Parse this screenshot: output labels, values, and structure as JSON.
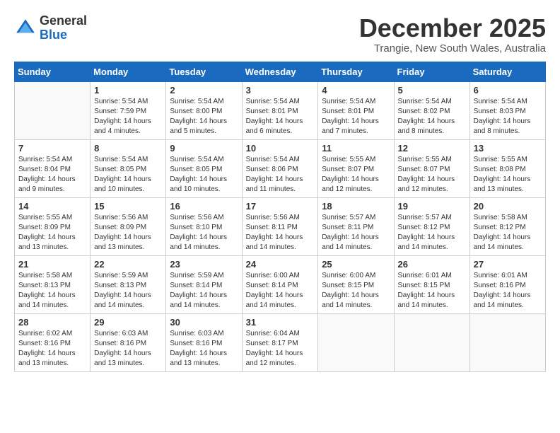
{
  "header": {
    "logo_general": "General",
    "logo_blue": "Blue",
    "month_title": "December 2025",
    "location": "Trangie, New South Wales, Australia"
  },
  "weekdays": [
    "Sunday",
    "Monday",
    "Tuesday",
    "Wednesday",
    "Thursday",
    "Friday",
    "Saturday"
  ],
  "weeks": [
    [
      {
        "day": "",
        "info": ""
      },
      {
        "day": "1",
        "info": "Sunrise: 5:54 AM\nSunset: 7:59 PM\nDaylight: 14 hours\nand 4 minutes."
      },
      {
        "day": "2",
        "info": "Sunrise: 5:54 AM\nSunset: 8:00 PM\nDaylight: 14 hours\nand 5 minutes."
      },
      {
        "day": "3",
        "info": "Sunrise: 5:54 AM\nSunset: 8:01 PM\nDaylight: 14 hours\nand 6 minutes."
      },
      {
        "day": "4",
        "info": "Sunrise: 5:54 AM\nSunset: 8:01 PM\nDaylight: 14 hours\nand 7 minutes."
      },
      {
        "day": "5",
        "info": "Sunrise: 5:54 AM\nSunset: 8:02 PM\nDaylight: 14 hours\nand 8 minutes."
      },
      {
        "day": "6",
        "info": "Sunrise: 5:54 AM\nSunset: 8:03 PM\nDaylight: 14 hours\nand 8 minutes."
      }
    ],
    [
      {
        "day": "7",
        "info": "Sunrise: 5:54 AM\nSunset: 8:04 PM\nDaylight: 14 hours\nand 9 minutes."
      },
      {
        "day": "8",
        "info": "Sunrise: 5:54 AM\nSunset: 8:05 PM\nDaylight: 14 hours\nand 10 minutes."
      },
      {
        "day": "9",
        "info": "Sunrise: 5:54 AM\nSunset: 8:05 PM\nDaylight: 14 hours\nand 10 minutes."
      },
      {
        "day": "10",
        "info": "Sunrise: 5:54 AM\nSunset: 8:06 PM\nDaylight: 14 hours\nand 11 minutes."
      },
      {
        "day": "11",
        "info": "Sunrise: 5:55 AM\nSunset: 8:07 PM\nDaylight: 14 hours\nand 12 minutes."
      },
      {
        "day": "12",
        "info": "Sunrise: 5:55 AM\nSunset: 8:07 PM\nDaylight: 14 hours\nand 12 minutes."
      },
      {
        "day": "13",
        "info": "Sunrise: 5:55 AM\nSunset: 8:08 PM\nDaylight: 14 hours\nand 13 minutes."
      }
    ],
    [
      {
        "day": "14",
        "info": "Sunrise: 5:55 AM\nSunset: 8:09 PM\nDaylight: 14 hours\nand 13 minutes."
      },
      {
        "day": "15",
        "info": "Sunrise: 5:56 AM\nSunset: 8:09 PM\nDaylight: 14 hours\nand 13 minutes."
      },
      {
        "day": "16",
        "info": "Sunrise: 5:56 AM\nSunset: 8:10 PM\nDaylight: 14 hours\nand 14 minutes."
      },
      {
        "day": "17",
        "info": "Sunrise: 5:56 AM\nSunset: 8:11 PM\nDaylight: 14 hours\nand 14 minutes."
      },
      {
        "day": "18",
        "info": "Sunrise: 5:57 AM\nSunset: 8:11 PM\nDaylight: 14 hours\nand 14 minutes."
      },
      {
        "day": "19",
        "info": "Sunrise: 5:57 AM\nSunset: 8:12 PM\nDaylight: 14 hours\nand 14 minutes."
      },
      {
        "day": "20",
        "info": "Sunrise: 5:58 AM\nSunset: 8:12 PM\nDaylight: 14 hours\nand 14 minutes."
      }
    ],
    [
      {
        "day": "21",
        "info": "Sunrise: 5:58 AM\nSunset: 8:13 PM\nDaylight: 14 hours\nand 14 minutes."
      },
      {
        "day": "22",
        "info": "Sunrise: 5:59 AM\nSunset: 8:13 PM\nDaylight: 14 hours\nand 14 minutes."
      },
      {
        "day": "23",
        "info": "Sunrise: 5:59 AM\nSunset: 8:14 PM\nDaylight: 14 hours\nand 14 minutes."
      },
      {
        "day": "24",
        "info": "Sunrise: 6:00 AM\nSunset: 8:14 PM\nDaylight: 14 hours\nand 14 minutes."
      },
      {
        "day": "25",
        "info": "Sunrise: 6:00 AM\nSunset: 8:15 PM\nDaylight: 14 hours\nand 14 minutes."
      },
      {
        "day": "26",
        "info": "Sunrise: 6:01 AM\nSunset: 8:15 PM\nDaylight: 14 hours\nand 14 minutes."
      },
      {
        "day": "27",
        "info": "Sunrise: 6:01 AM\nSunset: 8:16 PM\nDaylight: 14 hours\nand 14 minutes."
      }
    ],
    [
      {
        "day": "28",
        "info": "Sunrise: 6:02 AM\nSunset: 8:16 PM\nDaylight: 14 hours\nand 13 minutes."
      },
      {
        "day": "29",
        "info": "Sunrise: 6:03 AM\nSunset: 8:16 PM\nDaylight: 14 hours\nand 13 minutes."
      },
      {
        "day": "30",
        "info": "Sunrise: 6:03 AM\nSunset: 8:16 PM\nDaylight: 14 hours\nand 13 minutes."
      },
      {
        "day": "31",
        "info": "Sunrise: 6:04 AM\nSunset: 8:17 PM\nDaylight: 14 hours\nand 12 minutes."
      },
      {
        "day": "",
        "info": ""
      },
      {
        "day": "",
        "info": ""
      },
      {
        "day": "",
        "info": ""
      }
    ]
  ]
}
